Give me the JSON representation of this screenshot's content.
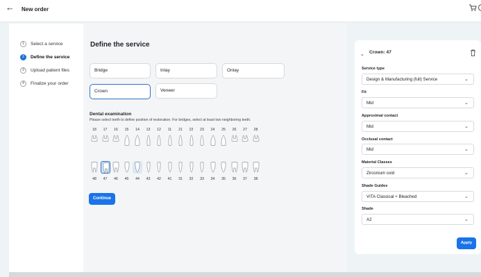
{
  "header": {
    "back_icon": "arrow-left-icon",
    "title": "New order"
  },
  "stepper": {
    "steps": [
      {
        "num": "1",
        "label": "Select a service",
        "active": false
      },
      {
        "num": "2",
        "label": "Define the service",
        "active": true
      },
      {
        "num": "3",
        "label": "Upload patient files",
        "active": false
      },
      {
        "num": "4",
        "label": "Finalize your order",
        "active": false
      }
    ]
  },
  "main": {
    "title": "Define the service",
    "services": [
      "Bridge",
      "Inlay",
      "Onlay",
      "Crown",
      "Veneer"
    ],
    "selected_service": "Crown",
    "exam_title": "Dental examination",
    "exam_help": "Please select teeth to define position of restoration. For bridges, select at least two neighboring teeth.",
    "upper_teeth": [
      "18",
      "17",
      "16",
      "15",
      "14",
      "13",
      "12",
      "11",
      "21",
      "22",
      "23",
      "24",
      "25",
      "26",
      "27",
      "28"
    ],
    "lower_teeth": [
      "48",
      "47",
      "46",
      "45",
      "44",
      "43",
      "42",
      "41",
      "31",
      "32",
      "33",
      "34",
      "35",
      "36",
      "37",
      "38"
    ],
    "selected_teeth": [
      "47",
      "44"
    ],
    "continue_label": "Continue"
  },
  "panel": {
    "title": "Crown: 47",
    "fields": [
      {
        "label": "Service type",
        "value": "Design & Manufacturing (full) Service"
      },
      {
        "label": "Fit",
        "value": "Mid"
      },
      {
        "label": "Approximal contact",
        "value": "Mid"
      },
      {
        "label": "Occlusal contact",
        "value": "Mid"
      },
      {
        "label": "Material Classes",
        "value": "Zirconium oxid"
      },
      {
        "label": "Shade Guides",
        "value": "VITA Classical + Bleached"
      },
      {
        "label": "Shade",
        "value": "A2"
      }
    ],
    "apply_label": "Apply"
  },
  "colors": {
    "accent": "#1a73e8",
    "background": "#eef4f6"
  }
}
